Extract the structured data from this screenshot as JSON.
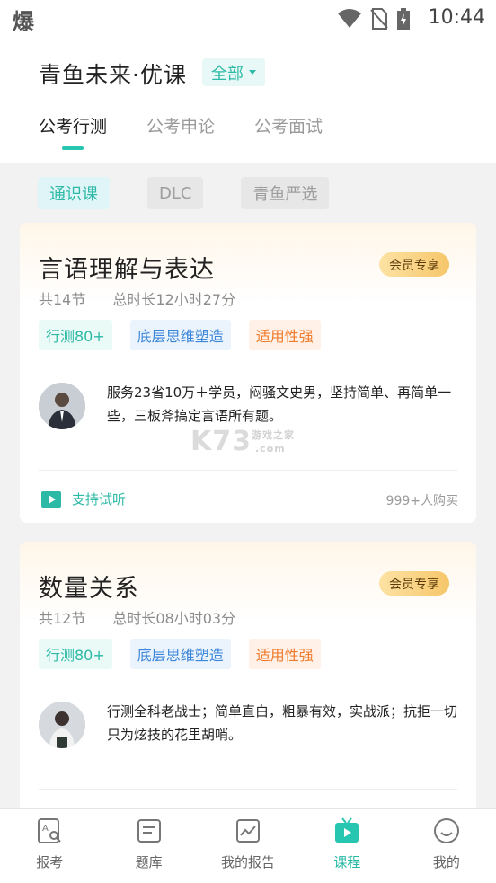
{
  "status": {
    "left_glyph": "爆",
    "time": "10:44"
  },
  "header": {
    "title": "青鱼未来·优课",
    "filter_label": "全部",
    "tabs": [
      {
        "label": "公考行测"
      },
      {
        "label": "公考申论"
      },
      {
        "label": "公考面试"
      }
    ]
  },
  "subtabs": [
    {
      "label": "通识课"
    },
    {
      "label": "DLC"
    },
    {
      "label": "青鱼严选"
    }
  ],
  "courses": [
    {
      "title": "言语理解与表达",
      "badge": "会员专享",
      "lessons": "共14节",
      "duration": "总时长12小时27分",
      "tags": [
        "行测80+",
        "底层思维塑造",
        "适用性强"
      ],
      "description": "服务23省10万＋学员，闷骚文史男，坚持简单、再简单一些，三板斧搞定言语所有题。",
      "trial": "支持试听",
      "buyers": "999+人购买"
    },
    {
      "title": "数量关系",
      "badge": "会员专享",
      "lessons": "共12节",
      "duration": "总时长08小时03分",
      "tags": [
        "行测80+",
        "底层思维塑造",
        "适用性强"
      ],
      "description": "行测全科老战士；简单直白，粗暴有效，实战派；抗拒一切只为炫技的花里胡哨。"
    }
  ],
  "watermark": "K73 游戏之家 .com",
  "bottom_nav": [
    {
      "label": "报考",
      "icon": "exam-register-icon"
    },
    {
      "label": "题库",
      "icon": "question-bank-icon"
    },
    {
      "label": "我的报告",
      "icon": "report-chart-icon"
    },
    {
      "label": "课程",
      "icon": "course-tv-icon"
    },
    {
      "label": "我的",
      "icon": "smile-profile-icon"
    }
  ],
  "colors": {
    "accent": "#26c6b0",
    "vip_gold": "#f6c66a"
  }
}
